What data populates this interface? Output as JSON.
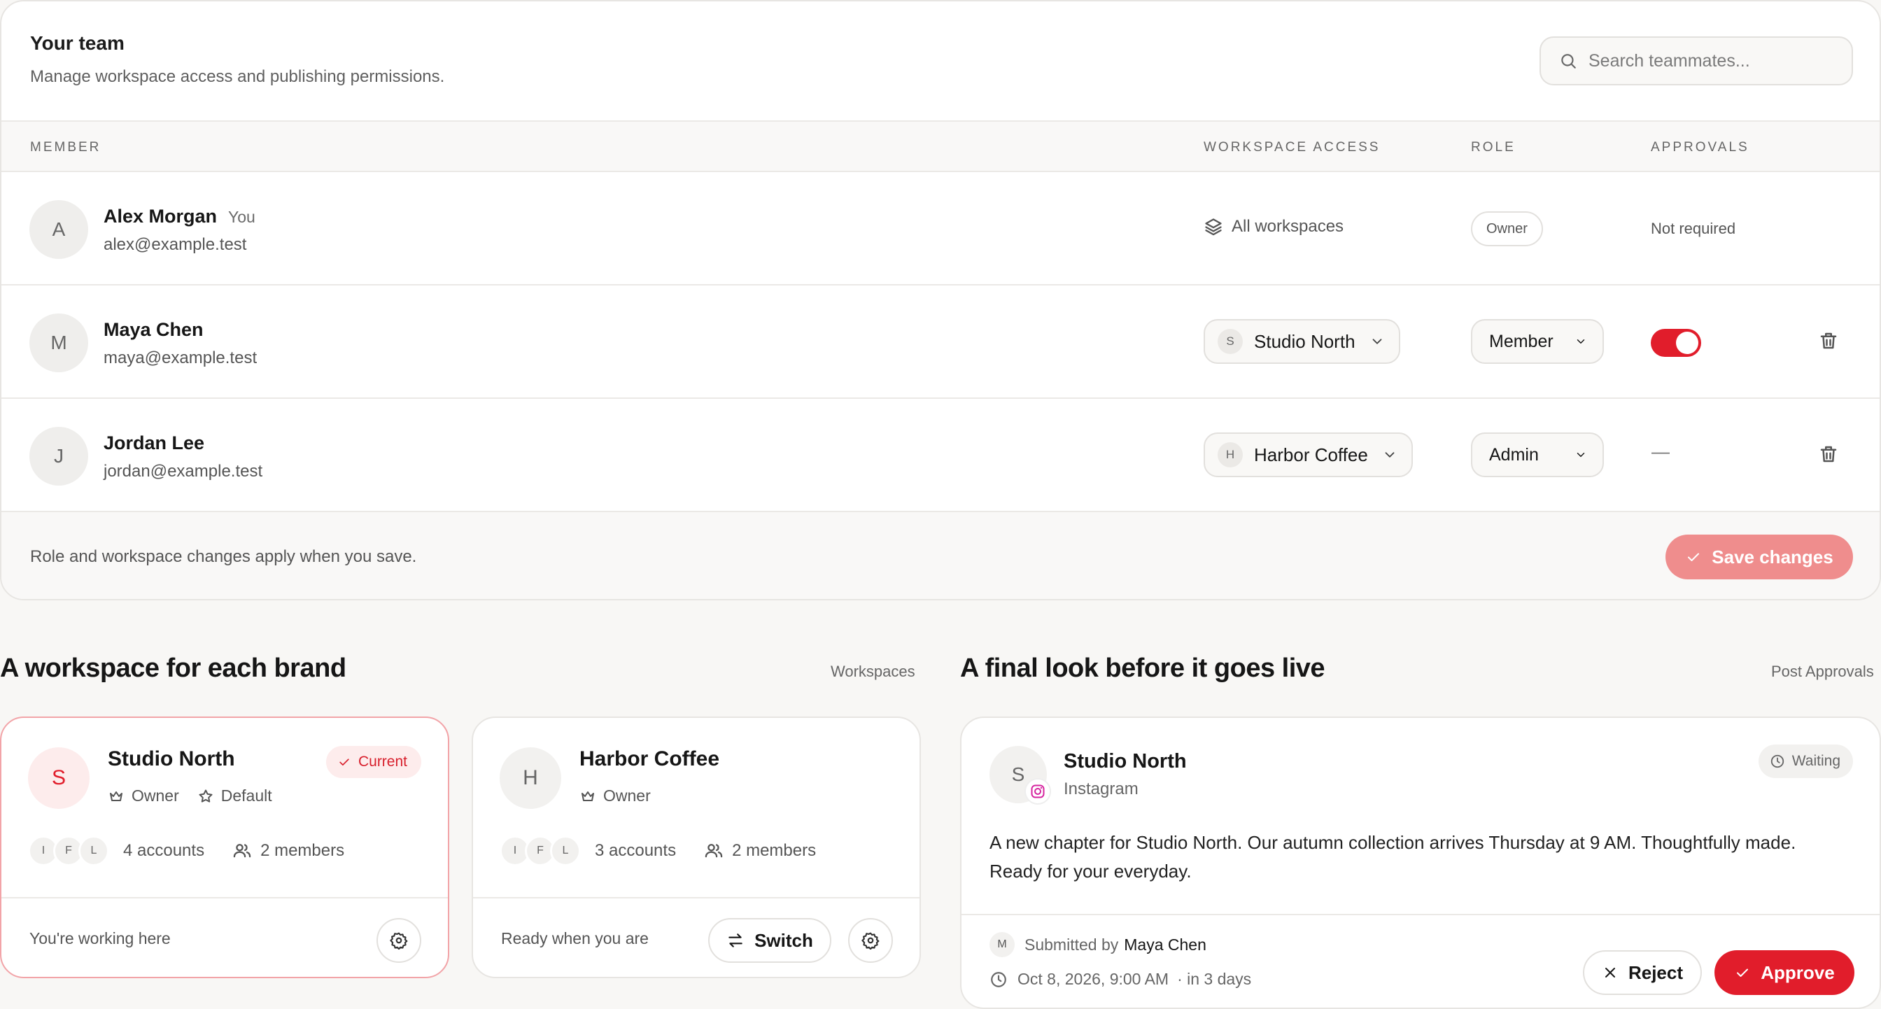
{
  "team": {
    "title": "Your team",
    "subtitle": "Manage workspace access and publishing permissions.",
    "search_placeholder": "Search teammates...",
    "columns": {
      "member": "MEMBER",
      "workspace_access": "WORKSPACE ACCESS",
      "role": "ROLE",
      "approvals": "APPROVALS"
    },
    "members": [
      {
        "initial": "A",
        "name": "Alex Morgan",
        "tag": "You",
        "email": "alex@example.test",
        "workspace": "All workspaces",
        "role": "Owner",
        "approvals": "Not required"
      },
      {
        "initial": "M",
        "name": "Maya Chen",
        "email": "maya@example.test",
        "workspace_initial": "S",
        "workspace": "Studio North",
        "role": "Member",
        "approvals_on": true
      },
      {
        "initial": "J",
        "name": "Jordan Lee",
        "email": "jordan@example.test",
        "workspace_initial": "H",
        "workspace": "Harbor Coffee",
        "role": "Admin",
        "approvals": "—"
      }
    ],
    "footer_note": "Role and workspace changes apply when you save.",
    "save_label": "Save changes"
  },
  "workspaces_section": {
    "title": "A workspace for each brand",
    "link": "Workspaces",
    "cards": [
      {
        "initial": "S",
        "name": "Studio North",
        "owner_label": "Owner",
        "default_label": "Default",
        "badge": "Current",
        "accounts": [
          "I",
          "F",
          "L"
        ],
        "accounts_label": "4 accounts",
        "members_label": "2 members",
        "footer_text": "You're working here"
      },
      {
        "initial": "H",
        "name": "Harbor Coffee",
        "owner_label": "Owner",
        "accounts": [
          "I",
          "F",
          "L"
        ],
        "accounts_label": "3 accounts",
        "members_label": "2 members",
        "footer_text": "Ready when you are",
        "switch_label": "Switch"
      }
    ]
  },
  "approvals_section": {
    "title": "A final look before it goes live",
    "link": "Post Approvals",
    "post": {
      "initial": "S",
      "brand": "Studio North",
      "network": "Instagram",
      "status": "Waiting",
      "body": "A new chapter for Studio North. Our autumn collection arrives Thursday at 9 AM. Thoughtfully made. Ready for your everyday.",
      "submitter_initial": "M",
      "submitted_by_label": "Submitted by",
      "submitted_by": "Maya Chen",
      "date": "Oct 8, 2026, 9:00 AM",
      "relative": "· in 3 days",
      "reject_label": "Reject",
      "approve_label": "Approve"
    }
  },
  "colors": {
    "accent": "#e11d2b",
    "accent_disabled": "#ef8d8d",
    "background": "#f8f7f5"
  }
}
